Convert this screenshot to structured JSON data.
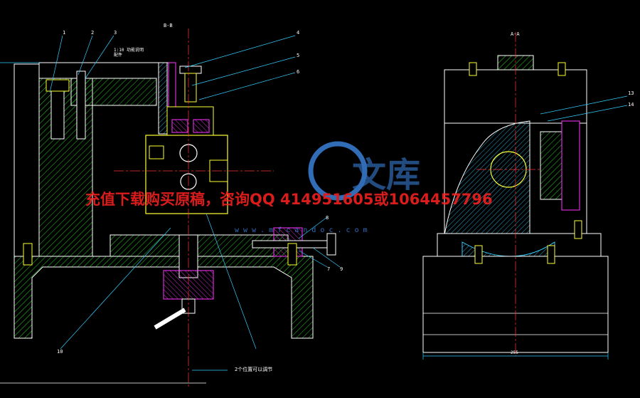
{
  "colors": {
    "background": "#000000",
    "outline": "#ffffff",
    "hatch": "#22cc22",
    "centerline": "#ff3333",
    "leader": "#33ccff",
    "yellow": "#ffff33",
    "magenta": "#ff33ff",
    "label": "#ffffff",
    "watermark_text": "#ff2222",
    "watermark_logo": "#3a7fd6"
  },
  "front_view": {
    "section_label": "B-B",
    "note_text": "1:10 功能说明\n配件",
    "bottom_note": "2个位置可以调节",
    "part_numbers": [
      "1",
      "2",
      "3",
      "4",
      "5",
      "6",
      "7",
      "8",
      "9",
      "10"
    ]
  },
  "side_view": {
    "section_label": "A-A",
    "part_numbers": [
      "13",
      "14"
    ],
    "dimension_label": "255"
  },
  "watermark": {
    "main_text": "充值下载购买原稿，咨询QQ 414951605或1064457796",
    "site_text": "w w w . m f c a n d o c . c o m",
    "logo_text": "文库"
  }
}
